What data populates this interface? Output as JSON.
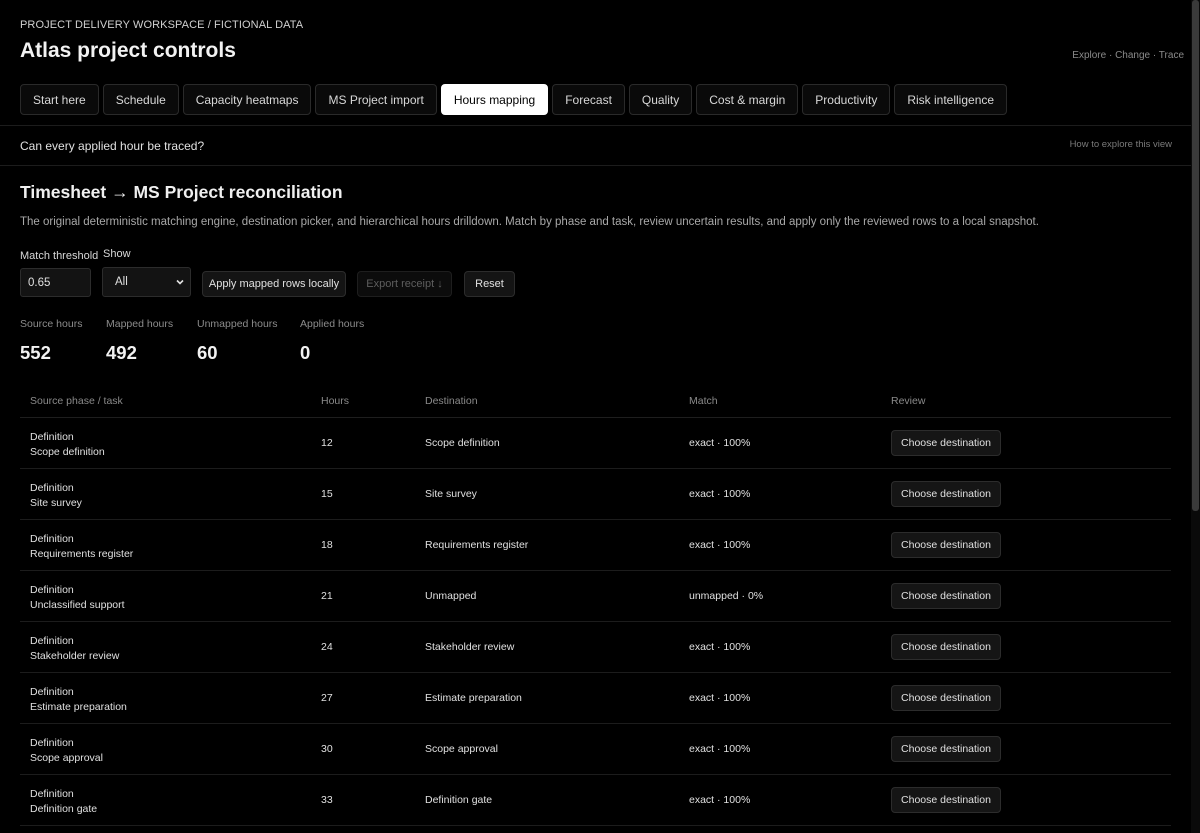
{
  "header": {
    "eyebrow": "PROJECT DELIVERY WORKSPACE / FICTIONAL DATA",
    "title": "Atlas project controls",
    "links": "Explore · Change · Trace"
  },
  "tabs": [
    {
      "label": "Start here",
      "active": false
    },
    {
      "label": "Schedule",
      "active": false
    },
    {
      "label": "Capacity heatmaps",
      "active": false
    },
    {
      "label": "MS Project import",
      "active": false
    },
    {
      "label": "Hours mapping",
      "active": true
    },
    {
      "label": "Forecast",
      "active": false
    },
    {
      "label": "Quality",
      "active": false
    },
    {
      "label": "Cost & margin",
      "active": false
    },
    {
      "label": "Productivity",
      "active": false
    },
    {
      "label": "Risk intelligence",
      "active": false
    }
  ],
  "question": {
    "text": "Can every applied hour be traced?",
    "help_link": "How to explore this view"
  },
  "section": {
    "title": "Timesheet → MS Project reconciliation",
    "description": "The original deterministic matching engine, destination picker, and hierarchical hours drilldown. Match by phase and task, review uncertain results, and apply only the reviewed rows to a local snapshot."
  },
  "controls": {
    "threshold_label": "Match threshold",
    "threshold_value": "0.65",
    "show_label": "Show",
    "show_value": "All",
    "apply_button": "Apply mapped rows locally",
    "export_button": "Export receipt ↓",
    "reset_button": "Reset"
  },
  "stats": [
    {
      "label": "Source hours",
      "value": "552"
    },
    {
      "label": "Mapped hours",
      "value": "492"
    },
    {
      "label": "Unmapped hours",
      "value": "60"
    },
    {
      "label": "Applied hours",
      "value": "0"
    }
  ],
  "table": {
    "headers": {
      "source": "Source phase / task",
      "hours": "Hours",
      "destination": "Destination",
      "match": "Match",
      "review": "Review"
    },
    "rows": [
      {
        "phase": "Definition",
        "task": "Scope definition",
        "hours": "12",
        "destination": "Scope definition",
        "match": "exact · 100%",
        "action": "Choose destination"
      },
      {
        "phase": "Definition",
        "task": "Site survey",
        "hours": "15",
        "destination": "Site survey",
        "match": "exact · 100%",
        "action": "Choose destination"
      },
      {
        "phase": "Definition",
        "task": "Requirements register",
        "hours": "18",
        "destination": "Requirements register",
        "match": "exact · 100%",
        "action": "Choose destination"
      },
      {
        "phase": "Definition",
        "task": "Unclassified support",
        "hours": "21",
        "destination": "Unmapped",
        "match": "unmapped · 0%",
        "action": "Choose destination"
      },
      {
        "phase": "Definition",
        "task": "Stakeholder review",
        "hours": "24",
        "destination": "Stakeholder review",
        "match": "exact · 100%",
        "action": "Choose destination"
      },
      {
        "phase": "Definition",
        "task": "Estimate preparation",
        "hours": "27",
        "destination": "Estimate preparation",
        "match": "exact · 100%",
        "action": "Choose destination"
      },
      {
        "phase": "Definition",
        "task": "Scope approval",
        "hours": "30",
        "destination": "Scope approval",
        "match": "exact · 100%",
        "action": "Choose destination"
      },
      {
        "phase": "Definition",
        "task": "Definition gate",
        "hours": "33",
        "destination": "Definition gate",
        "match": "exact · 100%",
        "action": "Choose destination"
      }
    ]
  }
}
